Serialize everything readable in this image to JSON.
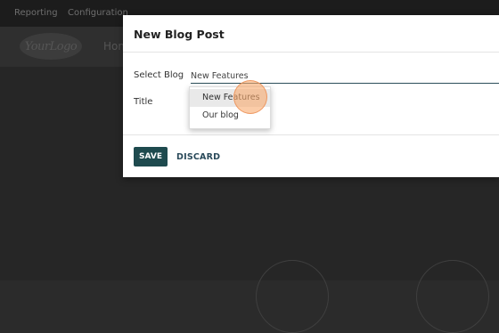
{
  "background": {
    "menus": [
      "Reporting",
      "Configuration"
    ],
    "logo_text": "YourLogo",
    "nav_home": "Hom"
  },
  "modal": {
    "title": "New Blog Post",
    "select_blog_label": "Select Blog",
    "select_blog_value": "New Features",
    "title_label": "Title",
    "save_label": "SAVE",
    "discard_label": "DISCARD"
  },
  "dropdown": {
    "options": [
      "New Features",
      "Our blog"
    ],
    "highlighted": "New Features"
  },
  "colors": {
    "primary": "#1e4a4e",
    "cursor_highlight": "#f8aa6e"
  }
}
